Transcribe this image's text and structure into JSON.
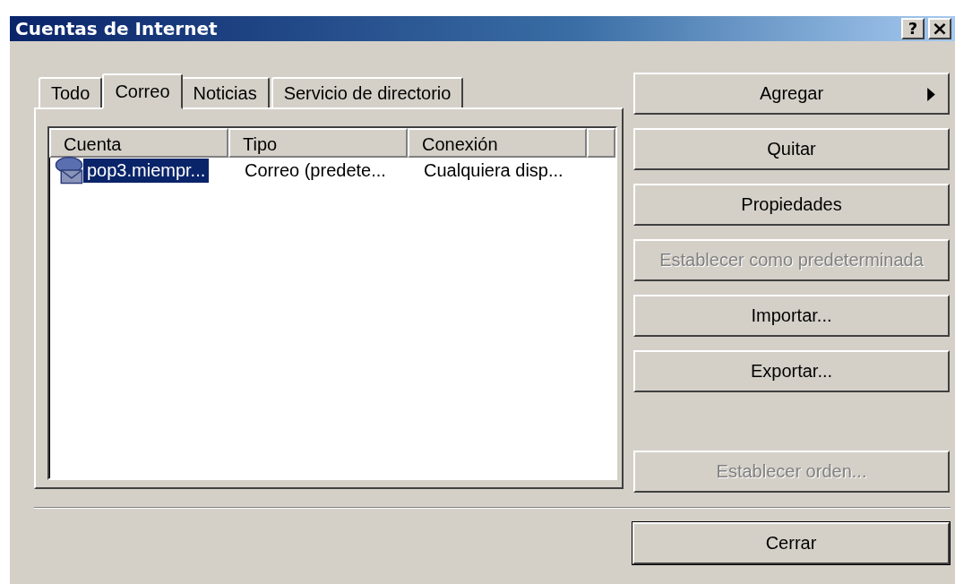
{
  "window": {
    "title": "Cuentas de Internet",
    "title_buttons": [
      {
        "kind": "help",
        "label": "?"
      },
      {
        "kind": "close",
        "label": "×"
      }
    ]
  },
  "tabs": [
    {
      "label": "Todo",
      "selected": false
    },
    {
      "label": "Correo",
      "selected": true
    },
    {
      "label": "Noticias",
      "selected": false
    },
    {
      "label": "Servicio de directorio",
      "selected": false
    }
  ],
  "table": {
    "columns": [
      "Cuenta",
      "Tipo",
      "Conexión"
    ],
    "rows": [
      {
        "cells": [
          "pop3.miempr...",
          "Correo (predete...",
          "Cualquiera disp..."
        ],
        "selected": true
      }
    ]
  },
  "buttons": [
    {
      "label": "Agregar",
      "disabled": false,
      "submenu": true
    },
    {
      "label": "Quitar",
      "disabled": false,
      "submenu": false
    },
    {
      "label": "Propiedades",
      "disabled": false,
      "submenu": false
    },
    {
      "label": "Establecer como predeterminada",
      "disabled": true,
      "submenu": false
    },
    {
      "label": "Importar...",
      "disabled": false,
      "submenu": false
    },
    {
      "label": "Exportar...",
      "disabled": false,
      "submenu": false
    }
  ],
  "order_button": {
    "label": "Establecer orden...",
    "disabled": true
  },
  "close_button": {
    "label": "Cerrar",
    "default": true
  }
}
